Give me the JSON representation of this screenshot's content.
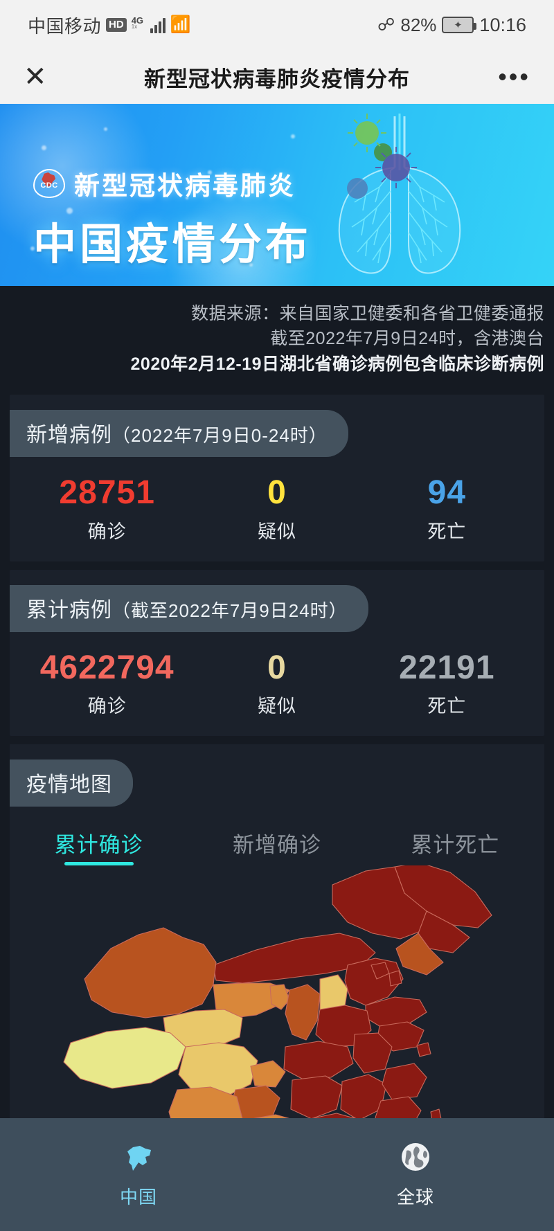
{
  "status_bar": {
    "carrier": "中国移动",
    "hd": "HD",
    "net": "4G",
    "net_sub": "1x",
    "wifi_icon": "wifi-icon",
    "bluetooth_icon": "bluetooth-icon",
    "battery_percent": "82%",
    "battery_icon": "battery-charging-icon",
    "time": "10:16"
  },
  "nav": {
    "close_icon": "close-icon",
    "title": "新型冠状病毒肺炎疫情分布",
    "more_icon": "more-options-icon",
    "more_glyph": "•••",
    "close_glyph": "✕"
  },
  "banner": {
    "logo": "cdc-logo",
    "logo_text": "CDC",
    "subtitle": "新型冠状病毒肺炎",
    "title": "中国疫情分布",
    "illustration": "lungs-illustration"
  },
  "source": {
    "line1": "数据来源：来自国家卫健委和各省卫健委通报",
    "line2": "截至2022年7月9日24时，含港澳台",
    "line3": "2020年2月12-19日湖北省确诊病例包含临床诊断病例"
  },
  "new_cases": {
    "pill_title": "新增病例",
    "pill_sub": "（2022年7月9日0-24时）",
    "stats": [
      {
        "value": "28751",
        "label": "确诊",
        "color": "#f03c30"
      },
      {
        "value": "0",
        "label": "疑似",
        "color": "#ffe23d"
      },
      {
        "value": "94",
        "label": "死亡",
        "color": "#4aa3e8"
      }
    ]
  },
  "total_cases": {
    "pill_title": "累计病例",
    "pill_sub": "（截至2022年7月9日24时）",
    "stats": [
      {
        "value": "4622794",
        "label": "确诊",
        "color": "#f2685e"
      },
      {
        "value": "0",
        "label": "疑似",
        "color": "#e8d9a0"
      },
      {
        "value": "22191",
        "label": "死亡",
        "color": "#a7aeb4"
      }
    ]
  },
  "map_section": {
    "pill_title": "疫情地图",
    "tabs": [
      {
        "label": "累计确诊",
        "active": true
      },
      {
        "label": "新增确诊",
        "active": false
      },
      {
        "label": "累计死亡",
        "active": false
      }
    ],
    "active_color": "#2fe8e0",
    "legend_colors": [
      "#8b1a13",
      "#b8531f",
      "#d9873a",
      "#e9c86a",
      "#e8e88a"
    ],
    "map_name": "china-choropleth-map"
  },
  "bottom_nav": {
    "items": [
      {
        "label": "中国",
        "icon": "china-map-icon",
        "active": true
      },
      {
        "label": "全球",
        "icon": "globe-icon",
        "active": false
      }
    ]
  }
}
